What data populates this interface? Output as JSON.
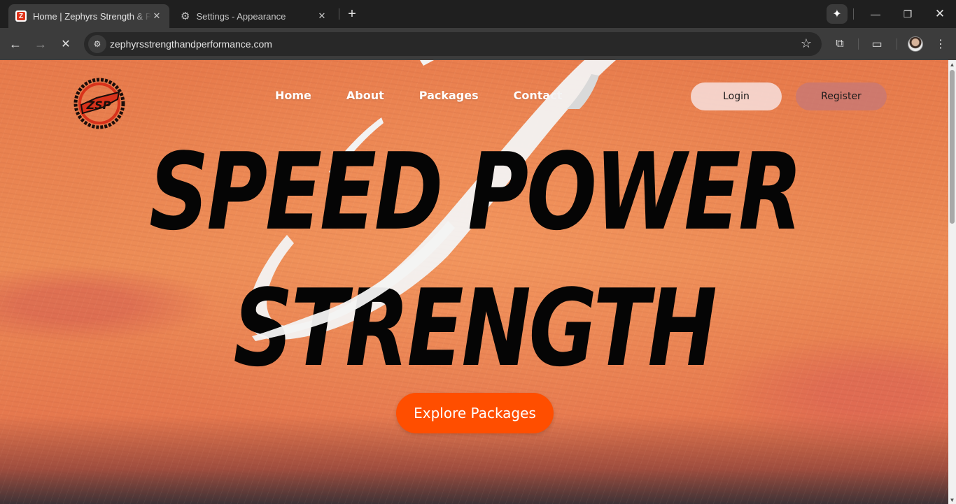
{
  "browser": {
    "tabs": [
      {
        "title": "Home | Zephyrs Strength & Performance",
        "favicon": "Z"
      },
      {
        "title": "Settings - Appearance",
        "favicon": "gear-icon"
      }
    ],
    "url": "zephyrsstrengthandperformance.com"
  },
  "site": {
    "logo_text": "ZSP",
    "nav": [
      "Home",
      "About",
      "Packages",
      "Contact"
    ],
    "login_label": "Login",
    "register_label": "Register",
    "hero_line1": "SPEED POWER",
    "hero_line2": "STRENGTH",
    "cta_label": "Explore Packages",
    "colors": {
      "accent": "#ff4e00",
      "background": "#e77a4b",
      "headline": "#050505"
    }
  }
}
